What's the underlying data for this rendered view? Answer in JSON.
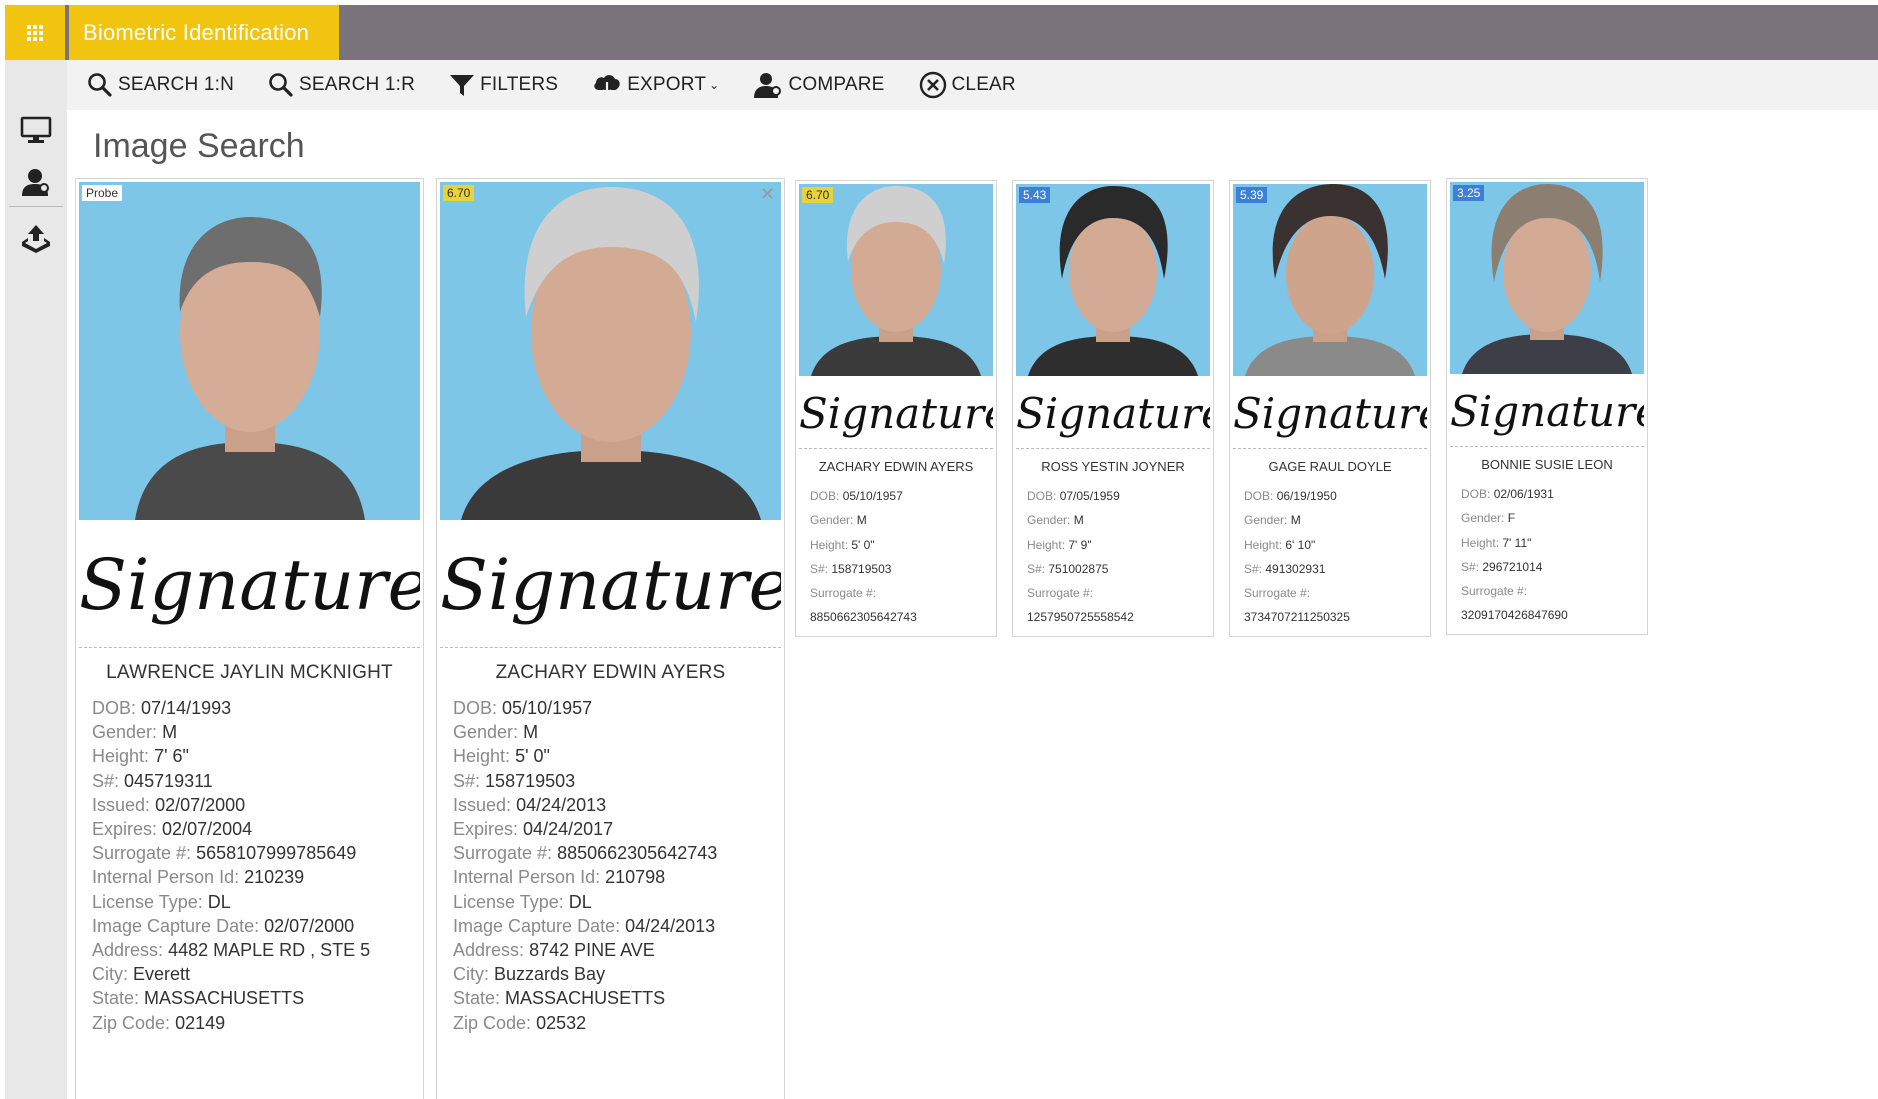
{
  "app": {
    "title": "Biometric Identification"
  },
  "toolbar": {
    "search_1n": "SEARCH 1:N",
    "search_1r": "SEARCH 1:R",
    "filters": "FILTERS",
    "export": "EXPORT",
    "compare": "COMPARE",
    "clear": "CLEAR"
  },
  "page": {
    "title": "Image Search"
  },
  "labels": {
    "dob": "DOB:",
    "gender": "Gender:",
    "height": "Height:",
    "snum": "S#:",
    "issued": "Issued:",
    "expires": "Expires:",
    "surrogate": "Surrogate #:",
    "internal_id": "Internal Person Id:",
    "license_type": "License Type:",
    "capture_date": "Image Capture Date:",
    "address": "Address:",
    "city": "City:",
    "state": "State:",
    "zip": "Zip Code:"
  },
  "signature_text": "Signature",
  "probe": {
    "badge": "Probe",
    "name": "LAWRENCE JAYLIN MCKNIGHT",
    "dob": "07/14/1993",
    "gender": "M",
    "height": "7' 6\"",
    "snum": "045719311",
    "issued": "02/07/2000",
    "expires": "02/07/2004",
    "surrogate": "5658107999785649",
    "internal_id": "210239",
    "license_type": "DL",
    "capture_date": "02/07/2000",
    "address": "4482 MAPLE RD , STE 5",
    "city": "Everett",
    "state": "MASSACHUSETTS",
    "zip": "02149"
  },
  "selected": {
    "badge": "6.70",
    "name": "ZACHARY EDWIN AYERS",
    "dob": "05/10/1957",
    "gender": "M",
    "height": "5' 0\"",
    "snum": "158719503",
    "issued": "04/24/2013",
    "expires": "04/24/2017",
    "surrogate": "8850662305642743",
    "internal_id": "210798",
    "license_type": "DL",
    "capture_date": "04/24/2013",
    "address": "8742 PINE AVE",
    "city": "Buzzards Bay",
    "state": "MASSACHUSETTS",
    "zip": "02532"
  },
  "results": [
    {
      "badge": "6.70",
      "badge_color": "#e6d43a",
      "name": "ZACHARY EDWIN AYERS",
      "dob": "05/10/1957",
      "gender": "M",
      "height": "5' 0\"",
      "snum": "158719503",
      "surrogate": "8850662305642743"
    },
    {
      "badge": "5.43",
      "badge_color": "#3b7fd6",
      "name": "ROSS YESTIN JOYNER",
      "dob": "07/05/1959",
      "gender": "M",
      "height": "7' 9\"",
      "snum": "751002875",
      "surrogate": "1257950725558542"
    },
    {
      "badge": "5.39",
      "badge_color": "#3b7fd6",
      "name": "GAGE RAUL DOYLE",
      "dob": "06/19/1950",
      "gender": "M",
      "height": "6' 10\"",
      "snum": "491302931",
      "surrogate": "3734707211250325"
    },
    {
      "badge": "3.25",
      "badge_color": "#3b7fd6",
      "name": "BONNIE SUSIE LEON",
      "dob": "02/06/1931",
      "gender": "F",
      "height": "7' 11\"",
      "snum": "296721014",
      "surrogate": "3209170426847690"
    }
  ],
  "colors": {
    "accent": "#f1c40f",
    "topbar": "#7a737c",
    "photo_bg": "#7dc6e8",
    "score_high": "#e6d43a",
    "score_other": "#3b7fd6"
  }
}
